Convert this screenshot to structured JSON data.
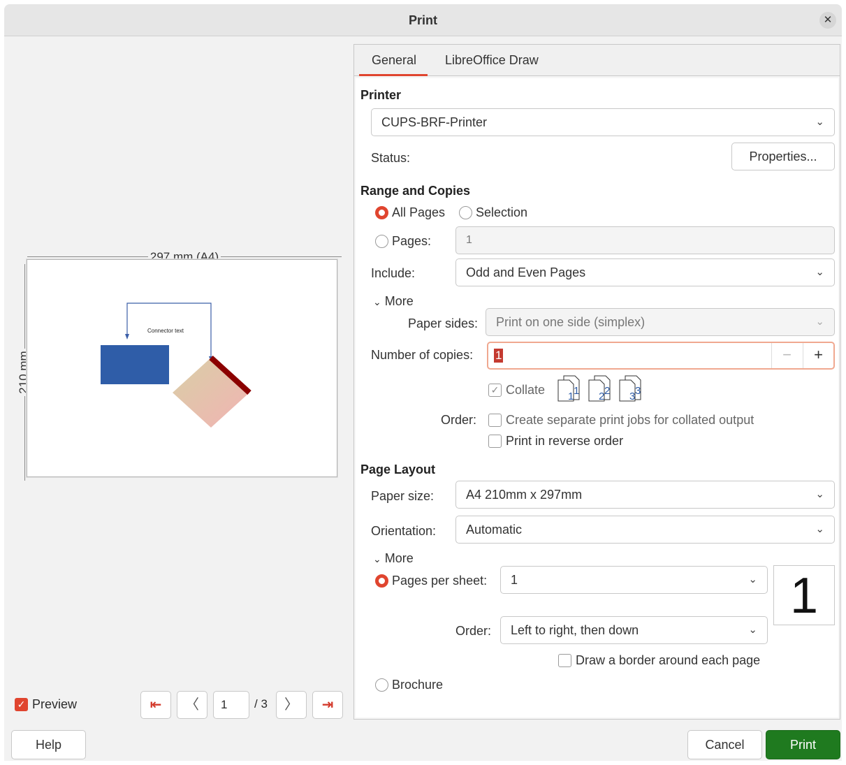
{
  "window": {
    "title": "Print"
  },
  "preview": {
    "width_label": "297 mm (A4)",
    "height_label": "210 mm",
    "connector_text": "Connector text",
    "checkbox_label": "Preview",
    "page_number": "1",
    "page_total": "/ 3"
  },
  "tabs": [
    "General",
    "LibreOffice Draw"
  ],
  "printer": {
    "section": "Printer",
    "selected": "CUPS-BRF-Printer",
    "status_label": "Status:",
    "properties_button": "Properties..."
  },
  "range": {
    "section": "Range and Copies",
    "all_pages": "All Pages",
    "selection": "Selection",
    "pages_label": "Pages:",
    "pages_value": "1",
    "include_label": "Include:",
    "include_value": "Odd and Even Pages",
    "more_label": "More",
    "paper_sides_label": "Paper sides:",
    "paper_sides_value": "Print on one side (simplex)",
    "copies_label": "Number of copies:",
    "copies_value": "1",
    "collate_label": "Collate",
    "order_label": "Order:",
    "separate_jobs_label": "Create separate print jobs for collated output",
    "reverse_label": "Print in reverse order"
  },
  "layout": {
    "section": "Page Layout",
    "paper_size_label": "Paper size:",
    "paper_size_value": "A4 210mm x 297mm",
    "orientation_label": "Orientation:",
    "orientation_value": "Automatic",
    "more_label": "More",
    "pages_per_sheet_label": "Pages per sheet:",
    "pages_per_sheet_value": "1",
    "order_label": "Order:",
    "order_value": "Left to right, then down",
    "border_label": "Draw a border around each page",
    "brochure_label": "Brochure",
    "pps_preview": "1"
  },
  "buttons": {
    "help": "Help",
    "cancel": "Cancel",
    "print": "Print"
  },
  "colors": {
    "accent": "#e0452f",
    "print_button": "#1f7a1f",
    "shape_blue": "#2f5da8",
    "shape_dark_red": "#8b0000"
  }
}
